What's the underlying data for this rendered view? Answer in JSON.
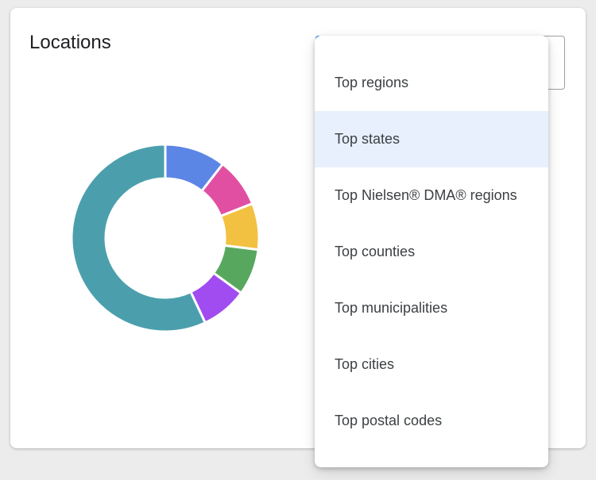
{
  "card": {
    "title": "Locations"
  },
  "chart_data": {
    "type": "pie",
    "variant": "donut",
    "slices": [
      {
        "value": 10.5,
        "color": "#5b86e5"
      },
      {
        "value": 8.5,
        "color": "#e14fa3"
      },
      {
        "value": 8.0,
        "color": "#f2c142"
      },
      {
        "value": 8.0,
        "color": "#57a85e"
      },
      {
        "value": 8.0,
        "color": "#a04cf0"
      },
      {
        "value": 57.0,
        "color": "#4b9fad"
      }
    ]
  },
  "menu": {
    "items": [
      {
        "label": "Top regions",
        "selected": false
      },
      {
        "label": "Top states",
        "selected": true
      },
      {
        "label": "Top Nielsen® DMA® regions",
        "selected": false
      },
      {
        "label": "Top counties",
        "selected": false
      },
      {
        "label": "Top municipalities",
        "selected": false
      },
      {
        "label": "Top cities",
        "selected": false
      },
      {
        "label": "Top postal codes",
        "selected": false
      }
    ]
  },
  "colors": {
    "accent": "#1a73e8",
    "selected_bg": "#e8f0fe"
  }
}
